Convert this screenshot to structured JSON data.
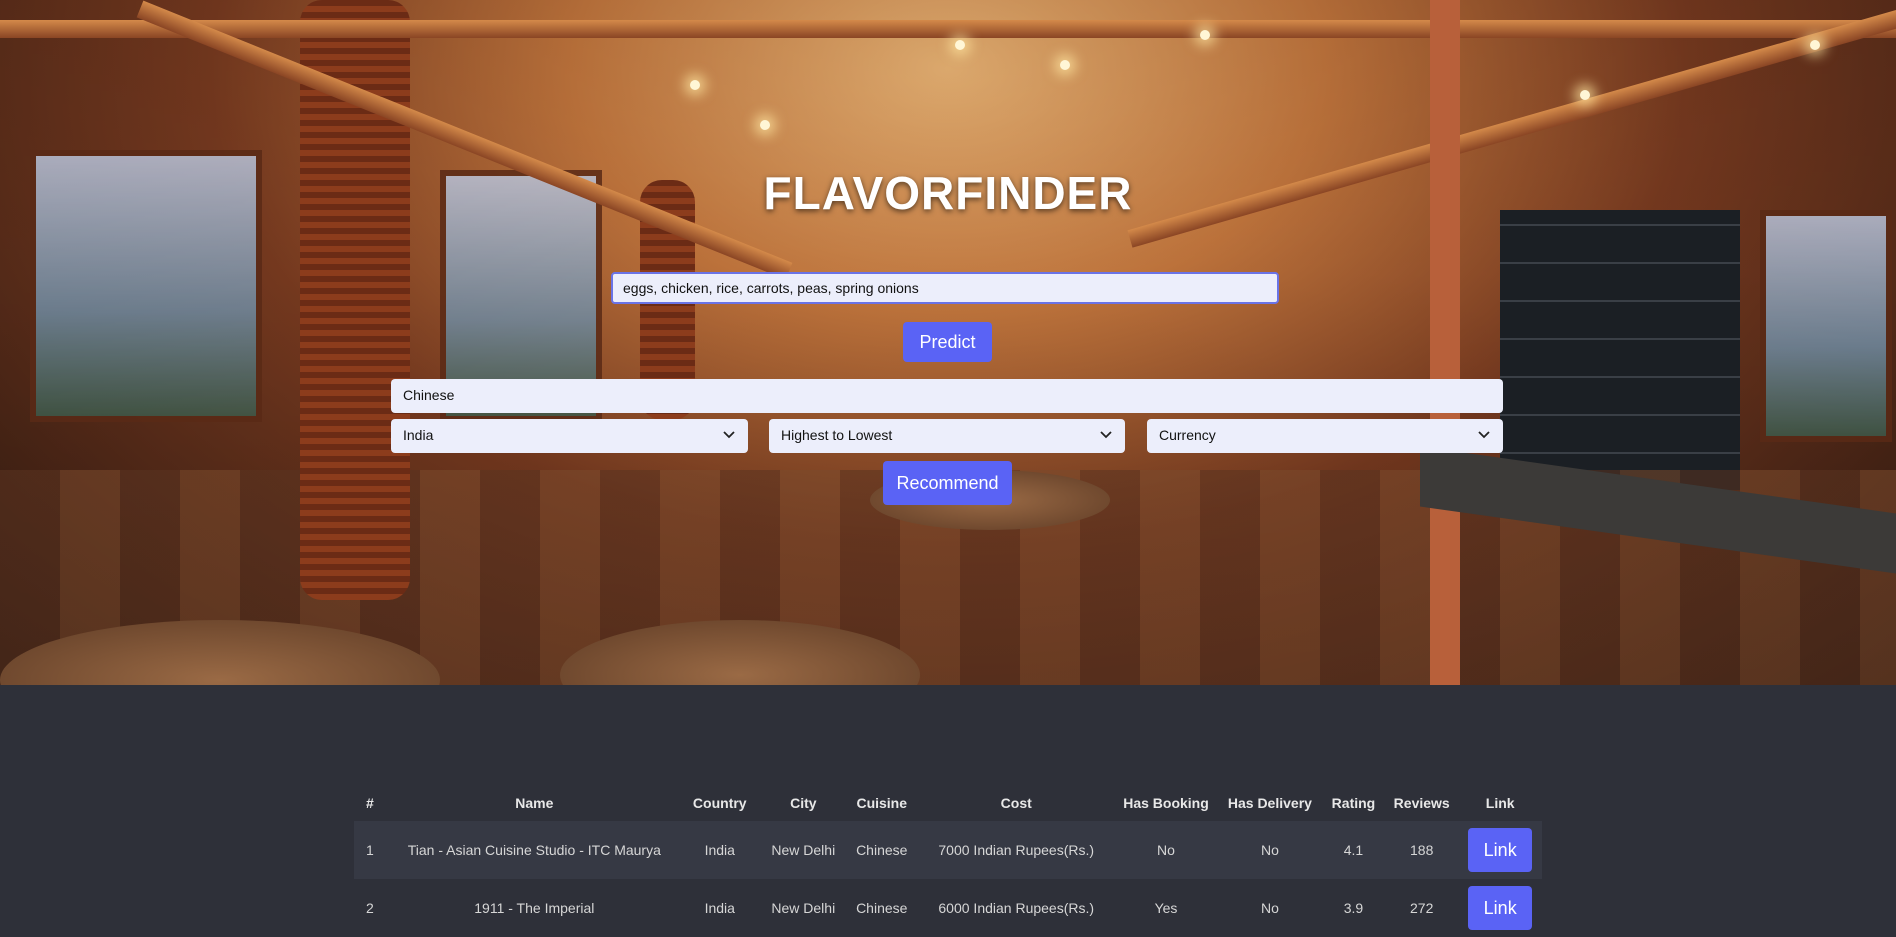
{
  "app": {
    "title": "FLAVORFINDER"
  },
  "predict_form": {
    "ingredients_value": "eggs, chicken, rice, carrots,  peas, spring onions",
    "predict_label": "Predict"
  },
  "recommend_form": {
    "cuisine_value": "Chinese",
    "country_selected": "India",
    "sort_selected": "Highest to Lowest",
    "currency_selected": "Currency",
    "recommend_label": "Recommend"
  },
  "results": {
    "headers": [
      "#",
      "Name",
      "Country",
      "City",
      "Cuisine",
      "Cost",
      "Has Booking",
      "Has Delivery",
      "Rating",
      "Reviews",
      "Link"
    ],
    "rows": [
      {
        "num": "1",
        "name": "Tian - Asian Cuisine Studio - ITC Maurya",
        "country": "India",
        "city": "New Delhi",
        "cuisine": "Chinese",
        "cost": "7000 Indian Rupees(Rs.)",
        "has_booking": "No",
        "has_delivery": "No",
        "rating": "4.1",
        "reviews": "188",
        "link_label": "Link"
      },
      {
        "num": "2",
        "name": "1911 - The Imperial",
        "country": "India",
        "city": "New Delhi",
        "cuisine": "Chinese",
        "cost": "6000 Indian Rupees(Rs.)",
        "has_booking": "Yes",
        "has_delivery": "No",
        "rating": "3.9",
        "reviews": "272",
        "link_label": "Link"
      }
    ]
  },
  "colors": {
    "accent": "#5a63f5",
    "page_bg": "#2e3039",
    "input_bg": "#eceefb"
  },
  "icons": {
    "select_caret": "chevron-down-icon"
  }
}
